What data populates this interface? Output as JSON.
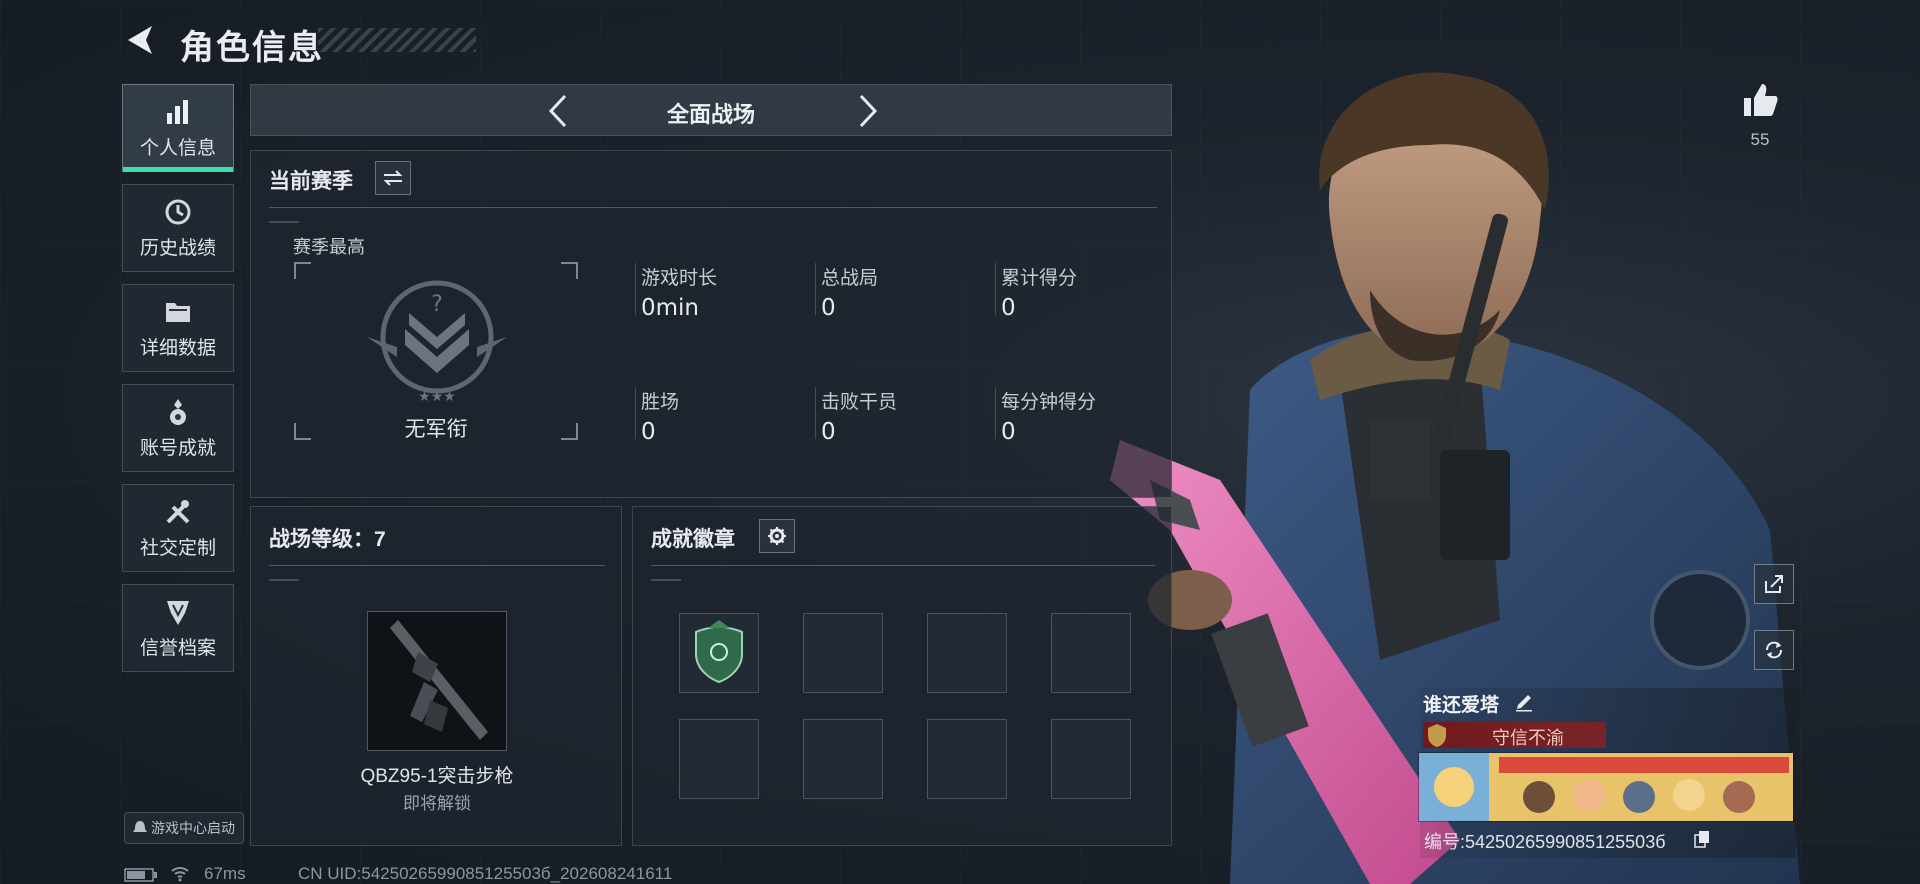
{
  "header": {
    "title": "角色信息"
  },
  "sidebar": {
    "items": [
      {
        "label": "个人信息",
        "icon": "bar-chart-icon",
        "active": true
      },
      {
        "label": "历史战绩",
        "icon": "history-clock-icon",
        "active": false
      },
      {
        "label": "详细数据",
        "icon": "folder-icon",
        "active": false
      },
      {
        "label": "账号成就",
        "icon": "achievement-medal-icon",
        "active": false
      },
      {
        "label": "社交定制",
        "icon": "tools-icon",
        "active": false
      },
      {
        "label": "信誉档案",
        "icon": "shield-emblem-icon",
        "active": false
      }
    ],
    "launch_label": "游戏中心启动"
  },
  "mode": {
    "title": "全面战场"
  },
  "season": {
    "heading": "当前赛季",
    "best_label": "赛季最高",
    "rank_name": "无军衔",
    "stats": [
      {
        "label": "游戏时长",
        "value": "0min"
      },
      {
        "label": "总战局",
        "value": "0"
      },
      {
        "label": "累计得分",
        "value": "0"
      },
      {
        "label": "胜场",
        "value": "0"
      },
      {
        "label": "击败干员",
        "value": "0"
      },
      {
        "label": "每分钟得分",
        "value": "0"
      }
    ]
  },
  "battlefield": {
    "heading": "战场等级：7",
    "weapon_name": "QBZ95-1突击步枪",
    "weapon_status": "即将解锁"
  },
  "badges": {
    "heading": "成就徽章"
  },
  "social": {
    "likes": "55"
  },
  "player": {
    "name": "谁还爱塔",
    "honor_title": "守信不渝",
    "id_line": "编号:5425026599085125503б"
  },
  "footer": {
    "ping": "67ms",
    "uid": "CN UID:5425026599085125503б_202608241611"
  },
  "colors": {
    "accent": "#3ee0a6",
    "honor_red": "#8c1c1c",
    "panel": "#1e262f"
  }
}
